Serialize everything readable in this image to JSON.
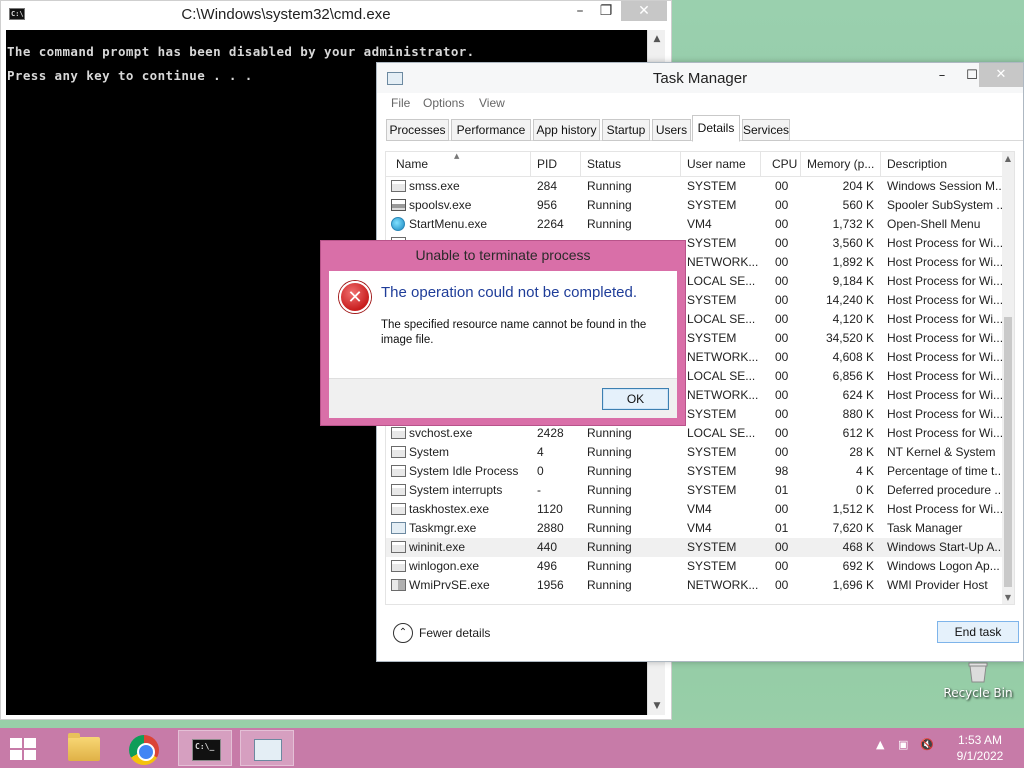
{
  "cmd": {
    "title": "C:\\Windows\\system32\\cmd.exe",
    "icon_text": "C:\\",
    "lines": [
      "The command prompt has been disabled by your administrator.",
      "Press any key to continue . . ."
    ]
  },
  "task_manager": {
    "title": "Task Manager",
    "menu": [
      "File",
      "Options",
      "View"
    ],
    "tabs": [
      "Processes",
      "Performance",
      "App history",
      "Startup",
      "Users",
      "Details",
      "Services"
    ],
    "active_tab": "Details",
    "columns": [
      "Name",
      "PID",
      "Status",
      "User name",
      "CPU",
      "Memory (p...",
      "Description"
    ],
    "rows": [
      {
        "icon": "window-icon",
        "name": "smss.exe",
        "pid": "284",
        "status": "Running",
        "user": "SYSTEM",
        "cpu": "00",
        "mem": "204 K",
        "desc": "Windows Session M..."
      },
      {
        "icon": "printer-icon",
        "name": "spoolsv.exe",
        "pid": "956",
        "status": "Running",
        "user": "SYSTEM",
        "cpu": "00",
        "mem": "560 K",
        "desc": "Spooler SubSystem ..."
      },
      {
        "icon": "globe-icon",
        "name": "StartMenu.exe",
        "pid": "2264",
        "status": "Running",
        "user": "VM4",
        "cpu": "00",
        "mem": "1,732 K",
        "desc": "Open-Shell Menu"
      },
      {
        "icon": "window-icon",
        "name": "",
        "pid": "",
        "status": "",
        "user": "SYSTEM",
        "cpu": "00",
        "mem": "3,560 K",
        "desc": "Host Process for Wi..."
      },
      {
        "icon": "window-icon",
        "name": "",
        "pid": "",
        "status": "",
        "user": "NETWORK...",
        "cpu": "00",
        "mem": "1,892 K",
        "desc": "Host Process for Wi..."
      },
      {
        "icon": "window-icon",
        "name": "",
        "pid": "",
        "status": "",
        "user": "LOCAL SE...",
        "cpu": "00",
        "mem": "9,184 K",
        "desc": "Host Process for Wi..."
      },
      {
        "icon": "window-icon",
        "name": "",
        "pid": "",
        "status": "",
        "user": "SYSTEM",
        "cpu": "00",
        "mem": "14,240 K",
        "desc": "Host Process for Wi..."
      },
      {
        "icon": "window-icon",
        "name": "",
        "pid": "",
        "status": "",
        "user": "LOCAL SE...",
        "cpu": "00",
        "mem": "4,120 K",
        "desc": "Host Process for Wi..."
      },
      {
        "icon": "window-icon",
        "name": "",
        "pid": "",
        "status": "",
        "user": "SYSTEM",
        "cpu": "00",
        "mem": "34,520 K",
        "desc": "Host Process for Wi..."
      },
      {
        "icon": "window-icon",
        "name": "",
        "pid": "",
        "status": "",
        "user": "NETWORK...",
        "cpu": "00",
        "mem": "4,608 K",
        "desc": "Host Process for Wi..."
      },
      {
        "icon": "window-icon",
        "name": "",
        "pid": "",
        "status": "",
        "user": "LOCAL SE...",
        "cpu": "00",
        "mem": "6,856 K",
        "desc": "Host Process for Wi..."
      },
      {
        "icon": "window-icon",
        "name": "",
        "pid": "",
        "status": "",
        "user": "NETWORK...",
        "cpu": "00",
        "mem": "624 K",
        "desc": "Host Process for Wi..."
      },
      {
        "icon": "window-icon",
        "name": "",
        "pid": "",
        "status": "",
        "user": "SYSTEM",
        "cpu": "00",
        "mem": "880 K",
        "desc": "Host Process for Wi..."
      },
      {
        "icon": "window-icon",
        "name": "svchost.exe",
        "pid": "2428",
        "status": "Running",
        "user": "LOCAL SE...",
        "cpu": "00",
        "mem": "612 K",
        "desc": "Host Process for Wi..."
      },
      {
        "icon": "window-icon",
        "name": "System",
        "pid": "4",
        "status": "Running",
        "user": "SYSTEM",
        "cpu": "00",
        "mem": "28 K",
        "desc": "NT Kernel & System"
      },
      {
        "icon": "window-icon",
        "name": "System Idle Process",
        "pid": "0",
        "status": "Running",
        "user": "SYSTEM",
        "cpu": "98",
        "mem": "4 K",
        "desc": "Percentage of time t..."
      },
      {
        "icon": "window-icon",
        "name": "System interrupts",
        "pid": "-",
        "status": "Running",
        "user": "SYSTEM",
        "cpu": "01",
        "mem": "0 K",
        "desc": "Deferred procedure ..."
      },
      {
        "icon": "window-icon",
        "name": "taskhostex.exe",
        "pid": "1120",
        "status": "Running",
        "user": "VM4",
        "cpu": "00",
        "mem": "1,512 K",
        "desc": "Host Process for Wi..."
      },
      {
        "icon": "taskmgr-icon",
        "name": "Taskmgr.exe",
        "pid": "2880",
        "status": "Running",
        "user": "VM4",
        "cpu": "01",
        "mem": "7,620 K",
        "desc": "Task Manager"
      },
      {
        "icon": "window-icon",
        "name": "wininit.exe",
        "pid": "440",
        "status": "Running",
        "user": "SYSTEM",
        "cpu": "00",
        "mem": "468 K",
        "desc": "Windows Start-Up A...",
        "selected": true
      },
      {
        "icon": "window-icon",
        "name": "winlogon.exe",
        "pid": "496",
        "status": "Running",
        "user": "SYSTEM",
        "cpu": "00",
        "mem": "692 K",
        "desc": "Windows Logon Ap..."
      },
      {
        "icon": "wmi-icon",
        "name": "WmiPrvSE.exe",
        "pid": "1956",
        "status": "Running",
        "user": "NETWORK...",
        "cpu": "00",
        "mem": "1,696 K",
        "desc": "WMI Provider Host"
      }
    ],
    "fewer_details": "Fewer details",
    "end_task": "End task"
  },
  "dialog": {
    "title": "Unable to terminate process",
    "main_instruction": "The operation could not be completed.",
    "content": "The specified resource name cannot be found in the image file.",
    "ok": "OK"
  },
  "desktop": {
    "recycle_bin": "Recycle Bin"
  },
  "taskbar": {
    "time": "1:53 AM",
    "date": "9/1/2022",
    "accent": "#c77ba8"
  },
  "colors": {
    "dialog_frame": "#d96fa8",
    "desktop": "#8fc4a4"
  }
}
